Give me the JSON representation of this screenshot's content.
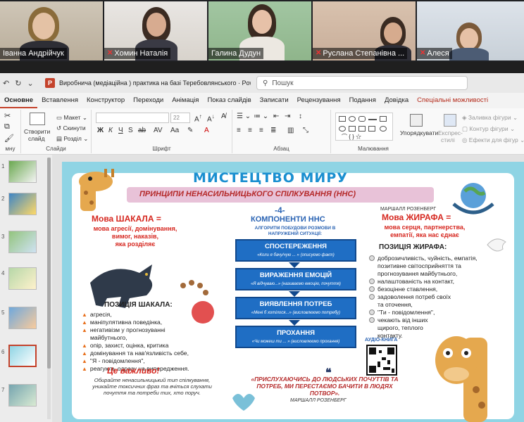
{
  "participants": [
    {
      "name": "Іванна Андрійчук",
      "muted": false,
      "active": false
    },
    {
      "name": "Хомин Наталія",
      "muted": true,
      "active": false
    },
    {
      "name": "Галина Дудун",
      "muted": false,
      "active": true
    },
    {
      "name": "Руслана Степанівна ...",
      "muted": true,
      "active": false
    },
    {
      "name": "Алеся",
      "muted": true,
      "active": false
    }
  ],
  "titlebar": {
    "document_title": "Виробнича (медіаційна ) практика на базі Теребовлянського  ·  PowerP...",
    "search_placeholder": "Пошук"
  },
  "tabs": [
    "Основне",
    "Вставлення",
    "Конструктор",
    "Переходи",
    "Анімація",
    "Показ слайдів",
    "Записати",
    "Рецензування",
    "Подання",
    "Довідка",
    "Спеціальні можливості"
  ],
  "ribbon": {
    "create_slide_line1": "Створити",
    "create_slide_line2": "слайд",
    "layout": "Макет",
    "reset": "Скинути",
    "section": "Розділ",
    "font_size": "22",
    "arrange": "Упорядкувати",
    "express_styles_line1": "Експрес-",
    "express_styles_line2": "стилі",
    "shape_fill": "Заливка фігури",
    "shape_outline": "Контур фігури",
    "shape_effects": "Ефекти для фігур",
    "group_labels": {
      "clipboard": "мну",
      "slides": "Слайди",
      "font": "Шрифт",
      "paragraph": "Абзац",
      "drawing": "Малювання"
    }
  },
  "thumbnails": [
    "1",
    "2",
    "3",
    "4",
    "5",
    "6",
    "7"
  ],
  "slide": {
    "title": "МИСТЕЦТВО МИРУ",
    "subtitle": "ПРИНЦИПИ НЕНАСИЛЬНИЦЬКОГО СПІЛКУВАННЯ (ННС)",
    "author_top": "МАРШАЛЛ РОЗЕНБЕРГ",
    "jackal": {
      "title": "Мова ШАКАЛА =",
      "subtitle_lines": [
        "мова агресії, домінування,",
        "вимог, наказів,",
        "яка розділяє"
      ],
      "position_title": "ПОЗИЦІЯ ШАКАЛА:",
      "items": [
        "агресія,",
        "маніпулятивна поведінка,",
        "негативізм у прогнозуванні",
        "майбутнього,",
        "опір, захист, оцінка, критика",
        "домінування та нав'язливість себе,",
        "\"Я - повідомлення\",",
        "реагують одразу на випередження."
      ]
    },
    "components": {
      "number": "-4-",
      "title": "КОМПОНЕНТИ ННС",
      "subtitle": "АЛГОРИТМ ПОБУДОВИ РОЗМОВИ В НАПРУЖЕНІЙ СИТУАЦІЇ:",
      "steps": [
        {
          "title": "СПОСТЕРЕЖЕННЯ",
          "desc": "«Коли я бачу/чую ... » (описуємо факт)"
        },
        {
          "title": "ВИРАЖЕННЯ ЕМОЦІЙ",
          "desc": "«Я відчуваю...» (називаємо емоцію, почуття)"
        },
        {
          "title": "ВИЯВЛЕННЯ ПОТРЕБ",
          "desc": "«Мені б хотілося...» (висловлюємо потребу)"
        },
        {
          "title": "ПРОХАННЯ",
          "desc": "«Чи можеш ти ... » (висловлюємо прохання)"
        }
      ]
    },
    "giraffe": {
      "title": "Мова ЖИРАФА =",
      "subtitle_lines": [
        "мова серця, партнерства,",
        "емпатії, яка нас єднає"
      ],
      "position_title": "ПОЗИЦІЯ ЖИРАФА:",
      "items": [
        "доброзичливість, чуйність, емпатія,",
        "позитивне світосприйняття та",
        "прогнозування майбутнього,",
        "налаштованість на контакт,",
        "безоцінне ставлення,",
        "задоволення потреб своїх",
        "та оточення,",
        "\"Ти - повідомлення\",",
        "чекають від інших",
        "щирого, теплого",
        "контакту."
      ]
    },
    "important_title": "Це важливо!",
    "important_text": "Обирайте ненасильницький тип спілкування, уникайте токсичних фраз та вчіться слухати почуття та потреби тих, хто поруч.",
    "quote": "«ПРИСЛУХАЮЧИСЬ ДО ЛЮДСЬКИХ ПОЧУТТІВ ТА ПОТРЕБ, МИ ПЕРЕСТАЄМО БАЧИТИ В ЛЮДЯХ ПОТВОР».",
    "author_bottom": "МАРШАЛЛ РОЗЕНБЕРГ",
    "audio_label": "АУДІО-КНИГА"
  }
}
